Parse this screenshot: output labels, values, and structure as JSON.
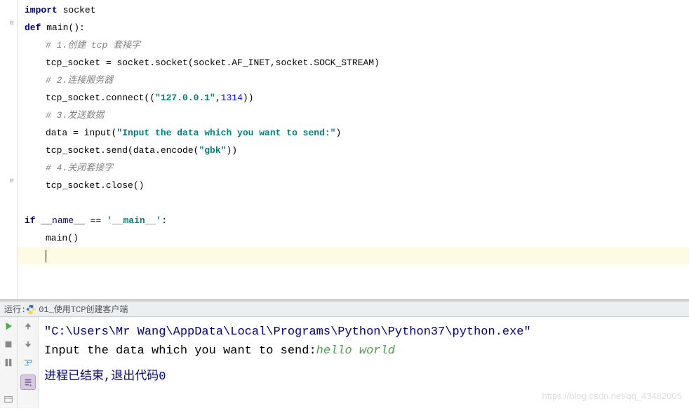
{
  "code": {
    "l1": {
      "kw": "import",
      "mod": "socket"
    },
    "l2": {
      "kw": "def",
      "name": "main",
      "parens": "():"
    },
    "l3": "# 1.创建 tcp 套接字",
    "l4": {
      "lhs": "tcp_socket = socket.socket(socket.",
      "c1": "AF_INET",
      "mid": ",socket.",
      "c2": "SOCK_STREAM",
      "end": ")"
    },
    "l5": "# 2.连接服务器",
    "l6": {
      "pre": "tcp_socket.connect((",
      "str": "\"127.0.0.1\"",
      "comma": ",",
      "num": "1314",
      "end": "))"
    },
    "l7": "# 3.发送数据",
    "l8": {
      "pre": "data = input(",
      "str": "\"Input the data which you want to send:\"",
      "end": ")"
    },
    "l9": {
      "pre": "tcp_socket.send(data.encode(",
      "str": "\"gbk\"",
      "end": "))"
    },
    "l10": "# 4.关闭套接字",
    "l11": "tcp_socket.close()",
    "l13": {
      "kw1": "if",
      "d1": "__name__",
      "eq": " == ",
      "str": "'__main__'",
      "colon": ":"
    },
    "l14": "main()"
  },
  "run": {
    "tab_label": "运行:",
    "config_name": "01_使用TCP创建客户端",
    "path": "\"C:\\Users\\Mr Wang\\AppData\\Local\\Programs\\Python\\Python37\\python.exe\"",
    "prompt": "Input the data which you want to send:",
    "input": "hello world",
    "exit": "进程已结束,退出代码0",
    "watermark": "https://blog.csdn.net/qq_43462005"
  }
}
